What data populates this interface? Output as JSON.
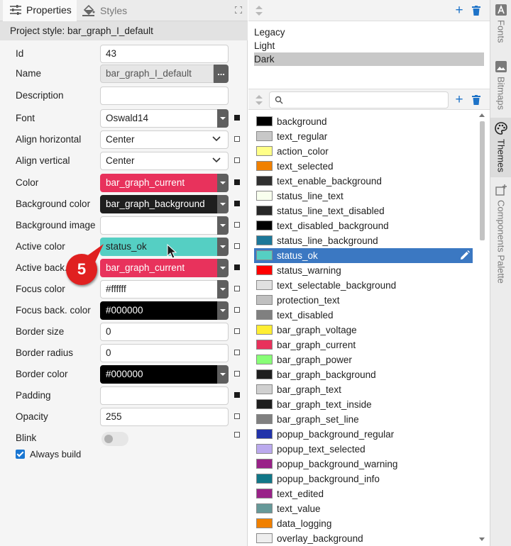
{
  "left_panel": {
    "tabs": [
      {
        "label": "Properties",
        "icon": "sliders-icon",
        "active": true
      },
      {
        "label": "Styles",
        "icon": "paint-bucket-icon",
        "active": false
      }
    ],
    "project_style_label": "Project style: bar_graph_I_default",
    "properties": {
      "id": {
        "label": "Id",
        "value": "43"
      },
      "name": {
        "label": "Name",
        "value": "bar_graph_I_default",
        "button": "..."
      },
      "description": {
        "label": "Description",
        "value": ""
      },
      "font": {
        "label": "Font",
        "value": "Oswald14"
      },
      "align_horizontal": {
        "label": "Align horizontal",
        "value": "Center"
      },
      "align_vertical": {
        "label": "Align vertical",
        "value": "Center"
      },
      "color": {
        "label": "Color",
        "value": "bar_graph_current",
        "bg": "#e8325c",
        "fg": "#ffffff"
      },
      "background_color": {
        "label": "Background color",
        "value": "bar_graph_background",
        "bg": "#1e1e1e",
        "fg": "#ffffff"
      },
      "background_image": {
        "label": "Background image",
        "value": ""
      },
      "active_color": {
        "label": "Active color",
        "value": "status_ok",
        "bg": "#55cfc3",
        "fg": "#222222"
      },
      "active_back": {
        "label": "Active back.",
        "value": "bar_graph_current",
        "bg": "#e8325c",
        "fg": "#ffffff"
      },
      "focus_color": {
        "label": "Focus color",
        "value": "#ffffff",
        "bg": "#ffffff",
        "fg": "#222222"
      },
      "focus_back_color": {
        "label": "Focus back. color",
        "value": "#000000",
        "bg": "#000000",
        "fg": "#ffffff"
      },
      "border_size": {
        "label": "Border size",
        "value": "0"
      },
      "border_radius": {
        "label": "Border radius",
        "value": "0"
      },
      "border_color": {
        "label": "Border color",
        "value": "#000000",
        "bg": "#000000",
        "fg": "#ffffff"
      },
      "padding": {
        "label": "Padding",
        "value": ""
      },
      "opacity": {
        "label": "Opacity",
        "value": "255"
      },
      "blink": {
        "label": "Blink",
        "on": false
      },
      "always_build": {
        "label": "Always build",
        "checked": true
      }
    },
    "callout_number": "5"
  },
  "themes": {
    "items": [
      "Legacy",
      "Light",
      "Dark"
    ],
    "selected": "Dark"
  },
  "colors": {
    "search_placeholder": "",
    "selected": "status_ok",
    "items": [
      {
        "name": "background",
        "color": "#000000"
      },
      {
        "name": "text_regular",
        "color": "#c8c8c8"
      },
      {
        "name": "action_color",
        "color": "#ffff88"
      },
      {
        "name": "text_selected",
        "color": "#f08000"
      },
      {
        "name": "text_enable_background",
        "color": "#303030"
      },
      {
        "name": "status_line_text",
        "color": "#f8ffee"
      },
      {
        "name": "status_line_text_disabled",
        "color": "#282828"
      },
      {
        "name": "text_disabled_background",
        "color": "#000000"
      },
      {
        "name": "status_line_background",
        "color": "#1c7799"
      },
      {
        "name": "status_ok",
        "color": "#55cfc3"
      },
      {
        "name": "status_warning",
        "color": "#ff0000"
      },
      {
        "name": "text_selectable_background",
        "color": "#e0e0e0"
      },
      {
        "name": "protection_text",
        "color": "#c0c0c0"
      },
      {
        "name": "text_disabled",
        "color": "#808080"
      },
      {
        "name": "bar_graph_voltage",
        "color": "#ffee33"
      },
      {
        "name": "bar_graph_current",
        "color": "#e8325c"
      },
      {
        "name": "bar_graph_power",
        "color": "#88ff77"
      },
      {
        "name": "bar_graph_background",
        "color": "#1e1e1e"
      },
      {
        "name": "bar_graph_text",
        "color": "#d0d0d0"
      },
      {
        "name": "bar_graph_text_inside",
        "color": "#1e1e1e"
      },
      {
        "name": "bar_graph_set_line",
        "color": "#808080"
      },
      {
        "name": "popup_background_regular",
        "color": "#2233aa"
      },
      {
        "name": "popup_text_selected",
        "color": "#bbaaee"
      },
      {
        "name": "popup_background_warning",
        "color": "#992288"
      },
      {
        "name": "popup_background_info",
        "color": "#117788"
      },
      {
        "name": "text_edited",
        "color": "#992288"
      },
      {
        "name": "text_value",
        "color": "#669999"
      },
      {
        "name": "data_logging",
        "color": "#f08000"
      },
      {
        "name": "overlay_background",
        "color": "#eeeeee"
      }
    ]
  },
  "right_sidebar": {
    "tabs": [
      {
        "label": "Fonts",
        "icon": "font-icon",
        "active": false
      },
      {
        "label": "Bitmaps",
        "icon": "image-icon",
        "active": false
      },
      {
        "label": "Themes",
        "icon": "palette-icon",
        "active": true
      },
      {
        "label": "Components Palette",
        "icon": "components-icon",
        "active": false
      }
    ]
  }
}
